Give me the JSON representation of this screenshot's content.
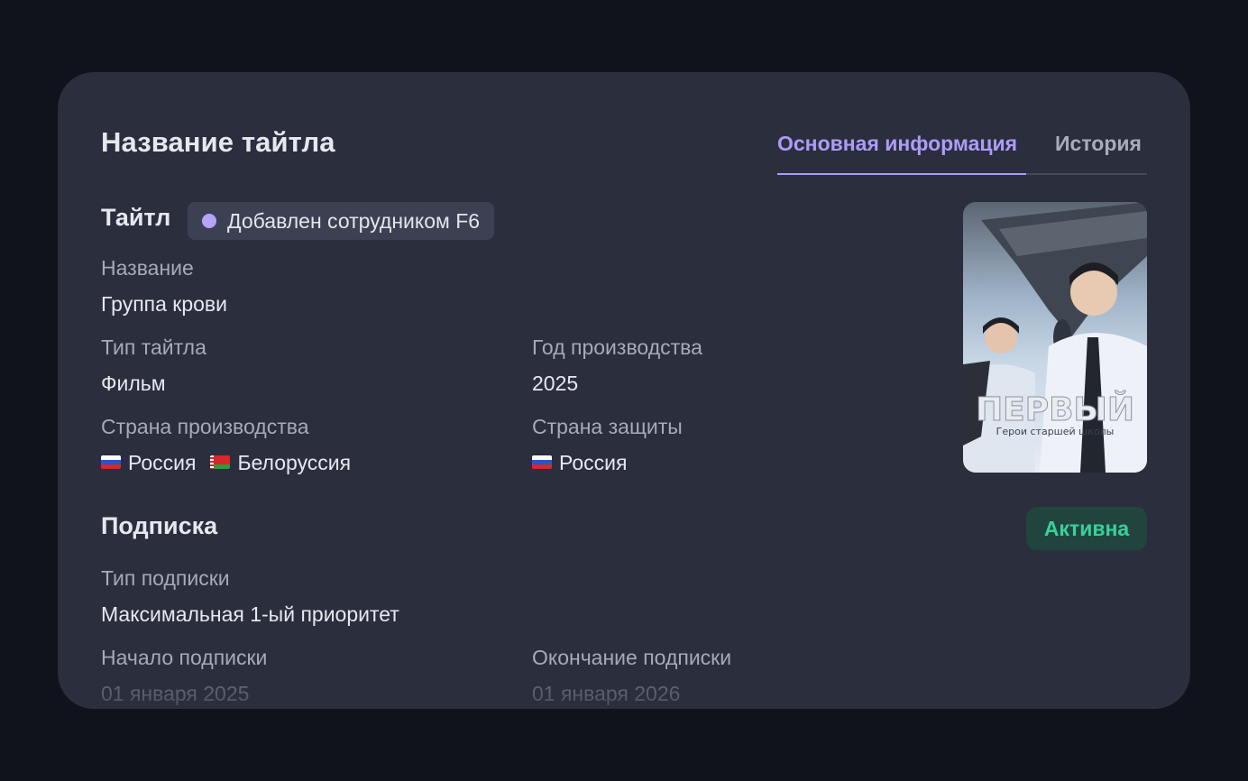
{
  "header": {
    "title": "Название тайтла",
    "tabs": [
      {
        "label": "Основная информация",
        "active": true
      },
      {
        "label": "История",
        "active": false
      }
    ]
  },
  "title_section": {
    "heading": "Тайтл",
    "badge": "Добавлен сотрудником F6",
    "name_label": "Название",
    "name_value": "Группа крови",
    "type_label": "Тип тайтла",
    "type_value": "Фильм",
    "year_label": "Год производства",
    "year_value": "2025",
    "production_country_label": "Страна производства",
    "production_countries": [
      {
        "name": "Россия",
        "flag": "flag-russia"
      },
      {
        "name": "Белоруссия",
        "flag": "flag-belarus"
      }
    ],
    "protection_country_label": "Страна защиты",
    "protection_countries": [
      {
        "name": "Россия",
        "flag": "flag-russia"
      }
    ],
    "poster": {
      "title_text": "ПЕРВЫЙ",
      "subtitle_text": "Герои старшей школы"
    }
  },
  "subscription": {
    "heading": "Подписка",
    "status": "Активна",
    "type_label": "Тип подписки",
    "type_value": "Максимальная 1-ый приоритет",
    "start_label": "Начало подписки",
    "start_value": "01 января 2025",
    "end_label": "Окончание подписки",
    "end_value": "01 января 2026"
  },
  "colors": {
    "page_bg": "#10131b",
    "card_bg": "#2a2e3d",
    "accent": "#ad9cf7",
    "status_active": "#35d39a",
    "status_active_bg": "#22443f"
  }
}
